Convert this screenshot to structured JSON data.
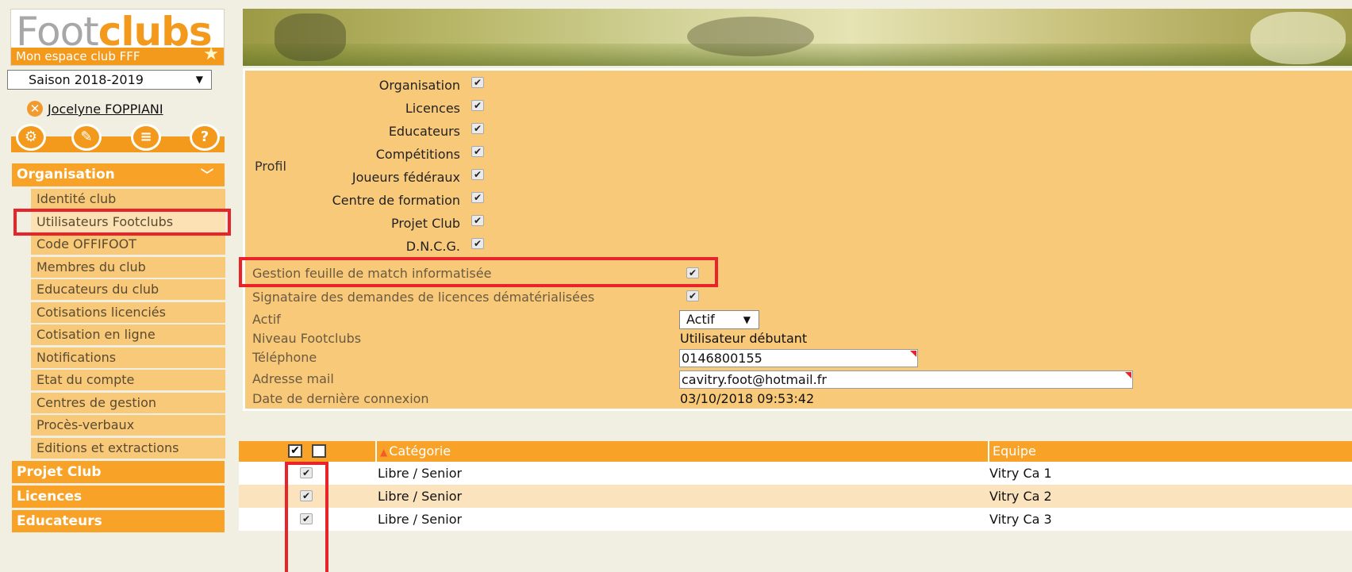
{
  "sidebar": {
    "logo": {
      "part1": "Foot",
      "part2": "clubs",
      "tagline": "Mon espace club FFF"
    },
    "season": "Saison 2018-2019",
    "user_name": "Jocelyne FOPPIANI",
    "icons": [
      "settings-icon",
      "edit-icon",
      "list-icon",
      "help-icon"
    ],
    "sections": {
      "organisation": "Organisation",
      "projet_club": "Projet Club",
      "licences": "Licences",
      "educateurs": "Educateurs"
    },
    "items": [
      {
        "label": "Identité club"
      },
      {
        "label": "Utilisateurs Footclubs"
      },
      {
        "label": "Code OFFIFOOT"
      },
      {
        "label": "Membres du club"
      },
      {
        "label": "Educateurs du club"
      },
      {
        "label": "Cotisations licenciés"
      },
      {
        "label": "Cotisation en ligne"
      },
      {
        "label": "Notifications"
      },
      {
        "label": "Etat du compte"
      },
      {
        "label": "Centres de gestion"
      },
      {
        "label": "Procès-verbaux"
      },
      {
        "label": "Editions et extractions"
      }
    ]
  },
  "profile": {
    "label": "Profil",
    "permissions": [
      {
        "label": "Organisation",
        "checked": true
      },
      {
        "label": "Licences",
        "checked": true
      },
      {
        "label": "Educateurs",
        "checked": true
      },
      {
        "label": "Compétitions",
        "checked": true
      },
      {
        "label": "Joueurs fédéraux",
        "checked": true
      },
      {
        "label": "Centre de formation",
        "checked": true
      },
      {
        "label": "Projet Club",
        "checked": true
      },
      {
        "label": "D.N.C.G.",
        "checked": true
      }
    ]
  },
  "fields": {
    "gestion_label": "Gestion feuille de match informatisée",
    "signataire_label": "Signataire des demandes de licences dématérialisées",
    "actif_label": "Actif",
    "actif_value": "Actif",
    "niveau_label": "Niveau Footclubs",
    "niveau_value": "Utilisateur débutant",
    "telephone_label": "Téléphone",
    "telephone_value": "0146800155",
    "mail_label": "Adresse mail",
    "mail_value": "cavitry.foot@hotmail.fr",
    "connexion_label": "Date de dernière connexion",
    "connexion_value": "03/10/2018 09:53:42"
  },
  "table": {
    "headers": {
      "categorie": "Catégorie",
      "equipe": "Equipe"
    },
    "rows": [
      {
        "checked": true,
        "categorie": "Libre / Senior",
        "equipe": "Vitry Ca 1"
      },
      {
        "checked": true,
        "categorie": "Libre / Senior",
        "equipe": "Vitry Ca 2"
      },
      {
        "checked": true,
        "categorie": "Libre / Senior",
        "equipe": "Vitry Ca 3"
      }
    ]
  },
  "colors": {
    "accent": "#f8a227",
    "panel": "#f9c97a",
    "highlight": "#e8232a"
  }
}
